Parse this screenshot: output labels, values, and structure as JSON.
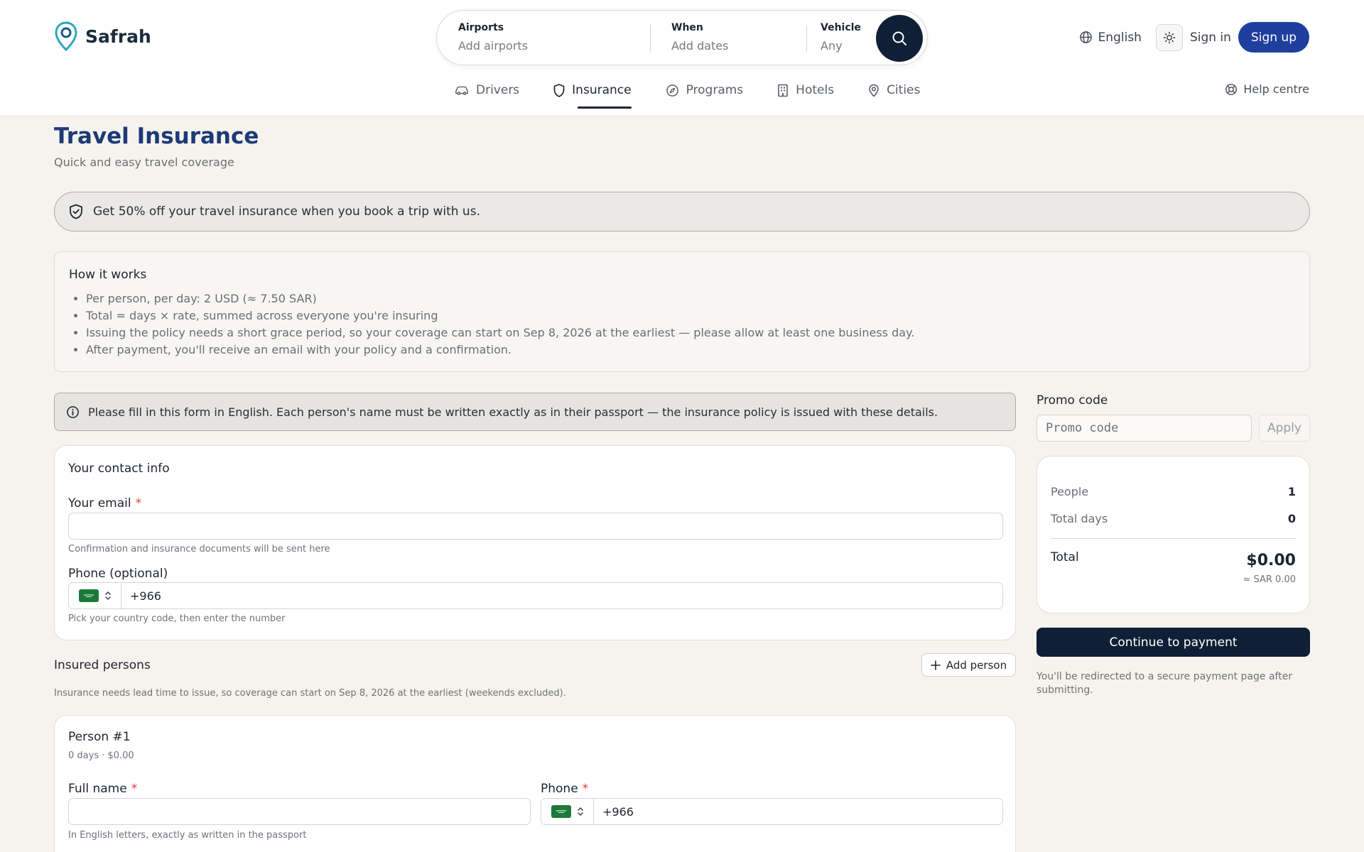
{
  "brand": {
    "name": "Safrah"
  },
  "search": {
    "airports": {
      "label": "Airports",
      "value": "Add airports"
    },
    "when": {
      "label": "When",
      "value": "Add dates"
    },
    "vehicle": {
      "label": "Vehicle",
      "value": "Any"
    }
  },
  "top_actions": {
    "language": "English",
    "sign_in": "Sign in",
    "sign_up": "Sign up"
  },
  "nav": {
    "items": [
      {
        "label": "Drivers",
        "icon": "car-icon"
      },
      {
        "label": "Insurance",
        "icon": "shield-icon",
        "active": true
      },
      {
        "label": "Programs",
        "icon": "compass-icon"
      },
      {
        "label": "Hotels",
        "icon": "building-icon"
      },
      {
        "label": "Cities",
        "icon": "map-pin-icon"
      }
    ],
    "help": "Help centre"
  },
  "page": {
    "title": "Travel Insurance",
    "subtitle": "Quick and easy travel coverage"
  },
  "banner": {
    "text": "Get 50% off your travel insurance when you book a trip with us."
  },
  "how_it_works": {
    "title": "How it works",
    "items": [
      "Per person, per day: 2 USD (≈ 7.50 SAR)",
      "Total = days × rate, summed across everyone you're insuring",
      "Issuing the policy needs a short grace period, so your coverage can start on Sep 8, 2026 at the earliest — please allow at least one business day.",
      "After payment, you'll receive an email with your policy and a confirmation."
    ]
  },
  "notice": {
    "text": "Please fill in this form in English. Each person's name must be written exactly as in their passport — the insurance policy is issued with these details."
  },
  "contact": {
    "title": "Your contact info",
    "email_label": "Your email",
    "required_mark": "*",
    "email_value": "",
    "email_hint": "Confirmation and insurance documents will be sent here",
    "phone_label": "Phone (optional)",
    "phone_value": "+966",
    "phone_hint": "Pick your country code, then enter the number"
  },
  "insured": {
    "title": "Insured persons",
    "add_button": "Add person",
    "note": "Insurance needs lead time to issue, so coverage can start on Sep 8, 2026 at the earliest (weekends excluded).",
    "persons": [
      {
        "title": "Person #1",
        "meta": "0 days · $0.00",
        "name_label": "Full name",
        "name_value": "",
        "name_hint": "In English letters, exactly as written in the passport",
        "phone_label": "Phone",
        "phone_value": "+966"
      }
    ]
  },
  "sidebar": {
    "promo_label": "Promo code",
    "promo_placeholder": "Promo code",
    "apply": "Apply",
    "summary": {
      "people_label": "People",
      "people_value": "1",
      "days_label": "Total days",
      "days_value": "0",
      "total_label": "Total",
      "total_value": "$0.00",
      "total_sar": "≈ SAR 0.00"
    },
    "pay_button": "Continue to payment",
    "pay_note": "You'll be redirected to a secure payment page after submitting."
  },
  "colors": {
    "accent": "#1e3f9e",
    "dark": "#0f1f35",
    "title": "#1c3a78",
    "background": "#f6f3ee",
    "required": "#e03a3a"
  }
}
